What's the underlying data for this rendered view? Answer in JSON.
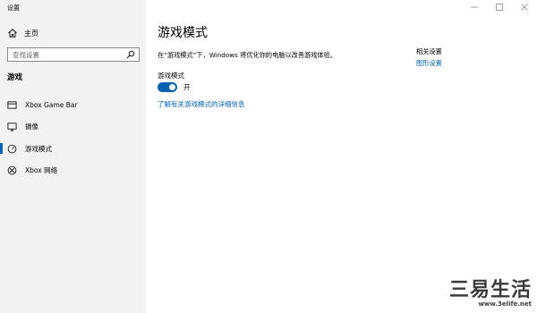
{
  "window": {
    "title": "设置"
  },
  "sidebar": {
    "home_label": "主页",
    "search_placeholder": "查找设置",
    "section_title": "游戏",
    "items": [
      {
        "label": "Xbox Game Bar",
        "icon": "game-bar-icon",
        "active": false
      },
      {
        "label": "摄像",
        "icon": "capture-icon",
        "active": false
      },
      {
        "label": "游戏模式",
        "icon": "game-mode-icon",
        "active": true
      },
      {
        "label": "Xbox 网络",
        "icon": "xbox-icon",
        "active": false
      }
    ]
  },
  "main": {
    "title": "游戏模式",
    "description": "在“游戏模式”下，Windows 将优化你的电脑以改善游戏体验。",
    "toggle": {
      "label": "游戏模式",
      "state_text": "开",
      "on": true
    },
    "learn_more": "了解有关游戏模式的详细信息"
  },
  "related": {
    "title": "相关设置",
    "link": "图形设置"
  },
  "watermark": {
    "text": "三易生活",
    "url": "www.3elife.net"
  },
  "colors": {
    "accent": "#0063b1",
    "sidebar_bg": "#f2f2f2"
  }
}
